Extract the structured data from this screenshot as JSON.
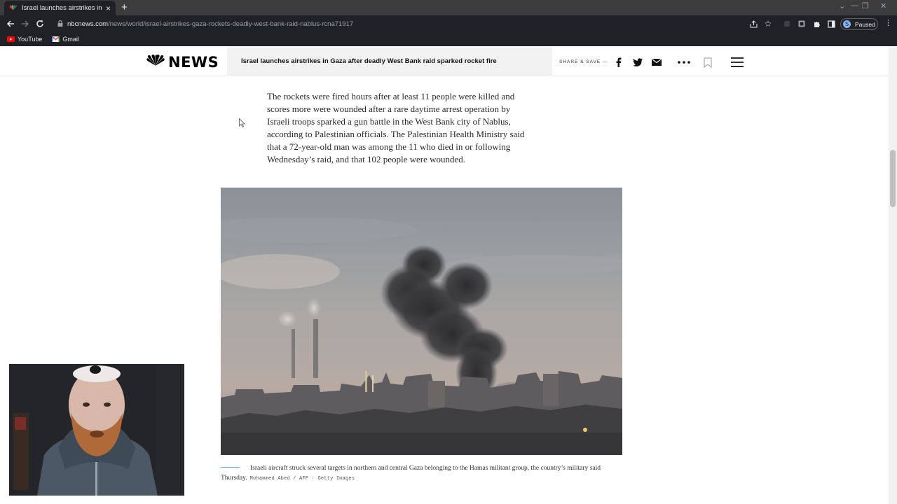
{
  "browser": {
    "tab_title": "Israel launches airstrikes in Gaza",
    "url_host": "nbcnews.com",
    "url_path": "/news/world/israel-airstrikes-gaza-rockets-deadly-west-bank-raid-nablus-rcna71917",
    "profile_initial": "S",
    "profile_status": "Paused",
    "bookmarks": [
      {
        "label": "YouTube",
        "icon": "youtube-icon"
      },
      {
        "label": "Gmail",
        "icon": "gmail-icon"
      }
    ]
  },
  "site": {
    "logo_text": "NEWS",
    "headline": "Israel launches airstrikes in Gaza after deadly West Bank raid sparked rocket fire",
    "share_label": "SHARE & SAVE —"
  },
  "article": {
    "paragraph": "The rockets were fired hours after at least 11 people were killed and scores more were wounded after a rare daytime arrest operation by Israeli troops sparked a gun battle in the West Bank city of Nablus, according to Palestinian officials. The Palestinian Health Ministry said that a 72-year-old man was among the 11 who died in or following Wednesday’s raid, and that 102 people were wounded.",
    "caption": "Israeli aircraft struck several targets in northern and central Gaza belonging to the Hamas militant group, the country’s military said Thursday.",
    "credit": "Mohammed Abed / AFP · Getty Images"
  },
  "colors": {
    "chrome_dark": "#202124",
    "tabstrip": "#3c3c3c",
    "headline_bg": "#f2f2f2",
    "caption_rule": "#6f9fd8"
  }
}
